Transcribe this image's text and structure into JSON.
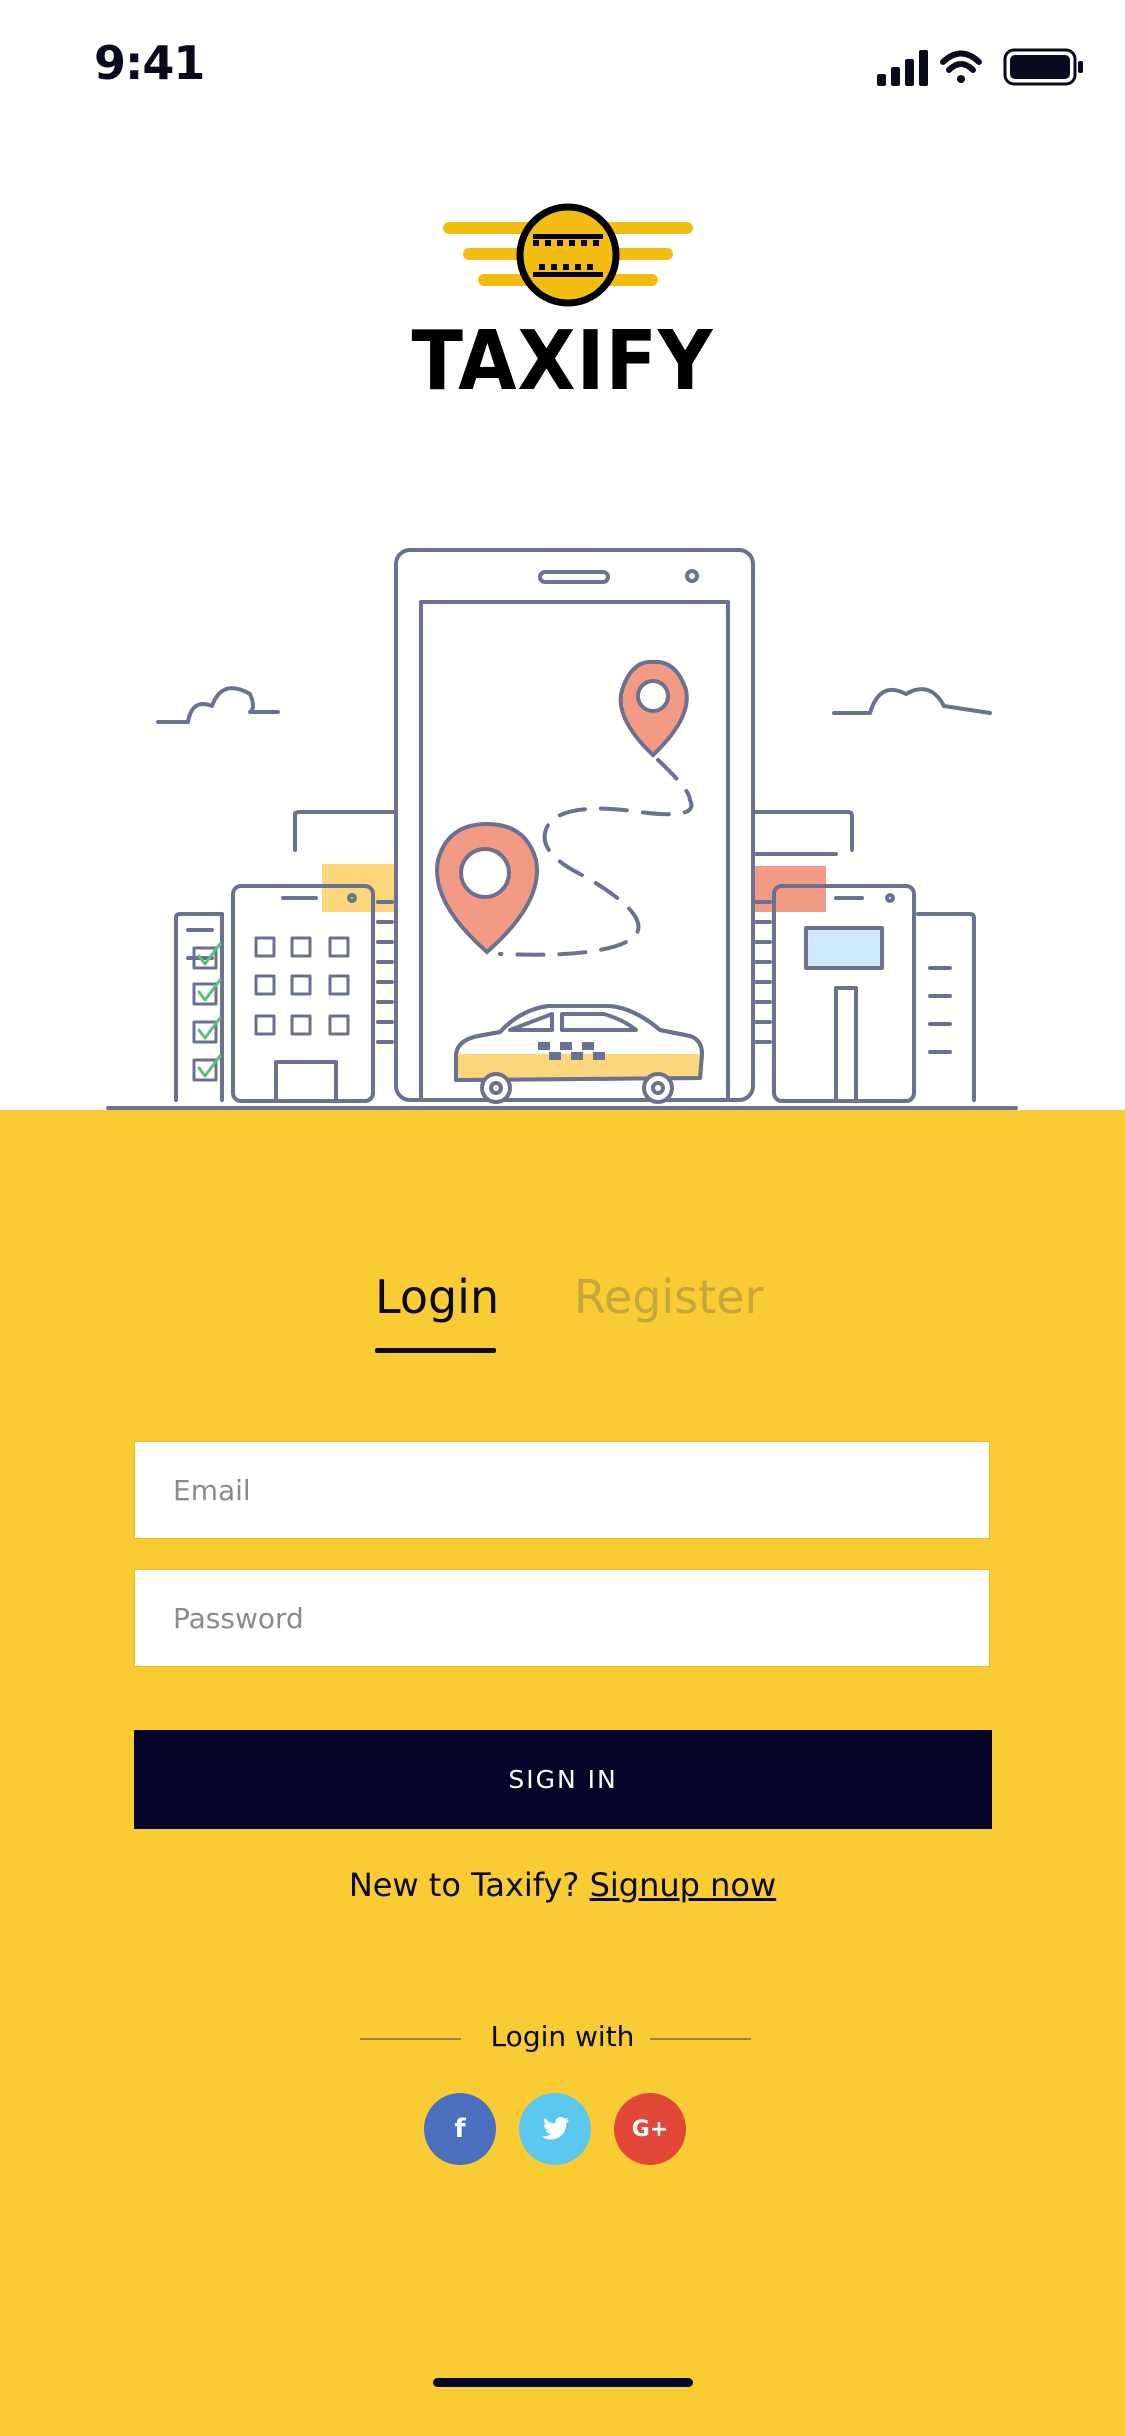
{
  "status_bar": {
    "time": "9:41"
  },
  "brand": {
    "name": "TAXIFY"
  },
  "tabs": [
    {
      "label": "Login",
      "active": true
    },
    {
      "label": "Register",
      "active": false
    }
  ],
  "form": {
    "email_placeholder": "Email",
    "password_placeholder": "Password",
    "submit_label": "SIGN IN"
  },
  "signup": {
    "prompt": "New to Taxify?",
    "link_label": "Signup now"
  },
  "social": {
    "label": "Login with",
    "providers": [
      {
        "name": "facebook",
        "glyph": "f",
        "color": "#4a6fbe"
      },
      {
        "name": "twitter",
        "glyph": "",
        "color": "#5ac8ef"
      },
      {
        "name": "google-plus",
        "glyph": "G+",
        "color": "#e2473a"
      }
    ]
  },
  "colors": {
    "accent": "#f9cc33",
    "dark": "#05052a",
    "pin": "#f0907c"
  },
  "icons": [
    "signal-icon",
    "wifi-icon",
    "battery-icon",
    "taxi-logo-icon",
    "facebook-icon",
    "twitter-icon",
    "google-plus-icon"
  ]
}
